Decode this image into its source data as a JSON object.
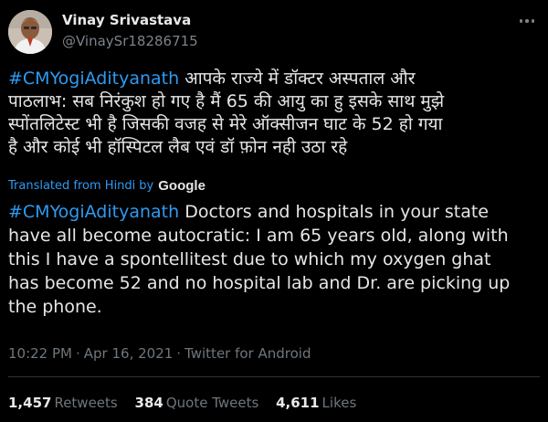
{
  "author": {
    "display_name": "Vinay Srivastava",
    "handle": "@VinaySr18286715"
  },
  "tweet": {
    "hindi_lines": [
      {
        "hashtag": "#CMYogiAdityanath",
        "text": " आपके राज्ये में डॉक्टर अस्पताल और"
      },
      {
        "hashtag": "",
        "text": "पाठलाभ: सब निरंकुश हो गए है मैं 65 की आयु का हु इसके साथ मुझे"
      },
      {
        "hashtag": "",
        "text": "स्पोंतलिटेस्ट  भी है जिसकी वजह से मेरे ऑक्सीजन घाट के 52 हो गया"
      },
      {
        "hashtag": "",
        "text": "है और कोई भी हॉस्पिटल लैब एवं डॉ फ़ोन नही उठा रहे"
      }
    ],
    "translated_label": "Translated from Hindi",
    "translated_by": "by",
    "translator": "Google",
    "english_lines": [
      {
        "hashtag": "#CMYogiAdityanath",
        "text": " Doctors and hospitals in your state"
      },
      {
        "hashtag": "",
        "text": "have all become autocratic: I am 65 years old, along with"
      },
      {
        "hashtag": "",
        "text": "this I have a spontellitest due to which my oxygen ghat"
      },
      {
        "hashtag": "",
        "text": "has become 52 and no hospital lab and Dr. are picking up"
      },
      {
        "hashtag": "",
        "text": "the phone."
      }
    ],
    "time": "10:22 PM",
    "date": "Apr 16, 2021",
    "source": "Twitter for Android",
    "separator": "·"
  },
  "stats": {
    "retweets_count": "1,457",
    "retweets_label": "Retweets",
    "quotes_count": "384",
    "quotes_label": "Quote Tweets",
    "likes_count": "4,611",
    "likes_label": "Likes"
  },
  "colors": {
    "background": "#000000",
    "link": "#2f9af2",
    "text": "#e6e6e6",
    "muted": "#6e767d"
  },
  "icons": {
    "more": "more-horizontal-icon"
  }
}
